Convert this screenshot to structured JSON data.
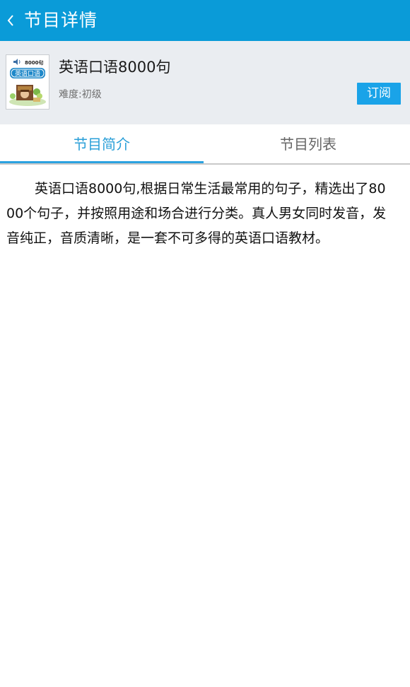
{
  "header": {
    "title": "节目详情",
    "back_icon": "chevron-left-icon",
    "bg_color": "#0a9bd8"
  },
  "program": {
    "title": "英语口语8000句",
    "difficulty": "难度:初级",
    "subscribe_label": "订阅",
    "cover": {
      "count_text": "8000句",
      "title_text": "英语口语"
    }
  },
  "tabs": {
    "items": [
      {
        "label": "节目简介",
        "active": true
      },
      {
        "label": "节目列表",
        "active": false
      }
    ],
    "active_color": "#2a9fd8"
  },
  "description": "英语口语8000句,根据日常生活最常用的句子，精选出了8000个句子，并按照用途和场合进行分类。真人男女同时发音，发音纯正，音质清晰，是一套不可多得的英语口语教材。"
}
